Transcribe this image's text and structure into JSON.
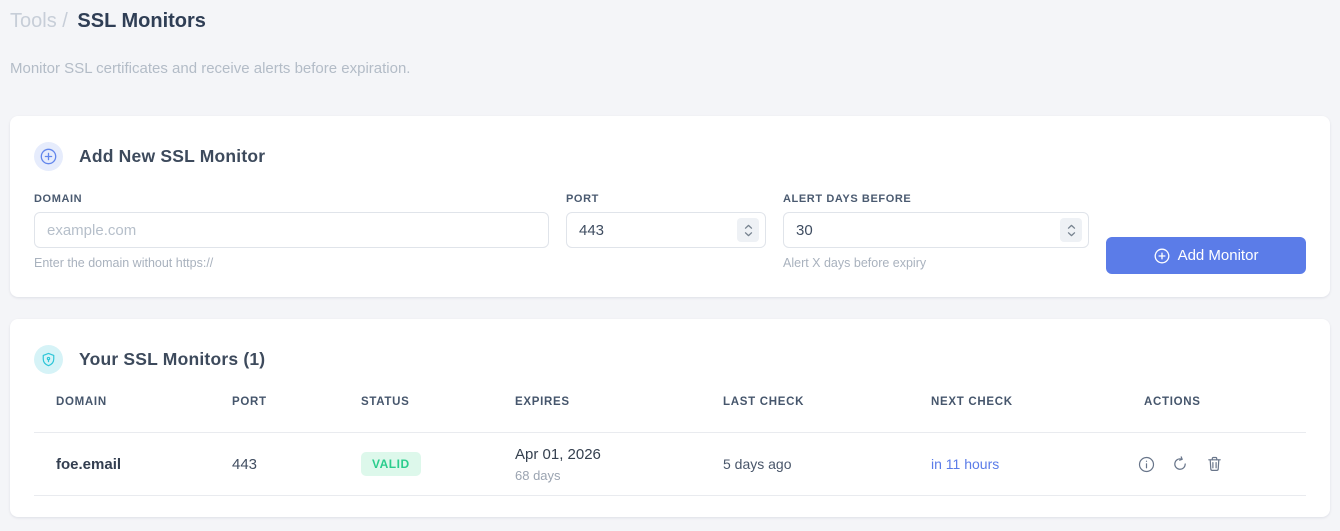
{
  "colors": {
    "accent": "#5b7ce8",
    "valid_badge_bg": "#ddf8eb",
    "valid_badge_text": "#2bcd8d",
    "page_bg": "#f4f5f8"
  },
  "breadcrumb": {
    "section": "Tools",
    "separator": "/",
    "current": "SSL Monitors"
  },
  "subtitle": "Monitor SSL certificates and receive alerts before expiration.",
  "add_form": {
    "title": "Add New SSL Monitor",
    "title_icon": "plus-circle-icon",
    "fields": {
      "domain": {
        "label": "DOMAIN",
        "placeholder": "example.com",
        "helper": "Enter the domain without https://"
      },
      "port": {
        "label": "PORT",
        "value": "443"
      },
      "alert_days": {
        "label": "ALERT DAYS BEFORE",
        "value": "30",
        "helper": "Alert X days before expiry"
      }
    },
    "submit_label": "Add Monitor",
    "submit_icon": "plus-circle-icon"
  },
  "monitors": {
    "title": "Your SSL Monitors (1)",
    "title_icon": "shield-icon",
    "count": 1,
    "columns": [
      "DOMAIN",
      "PORT",
      "STATUS",
      "EXPIRES",
      "LAST CHECK",
      "NEXT CHECK",
      "ACTIONS"
    ],
    "rows": [
      {
        "domain": "foe.email",
        "port": "443",
        "status": "VALID",
        "expires_date": "Apr 01, 2026",
        "expires_in": "68 days",
        "last_check": "5 days ago",
        "next_check": "in 11 hours",
        "actions": [
          "info-icon",
          "refresh-icon",
          "delete-icon"
        ]
      }
    ]
  }
}
